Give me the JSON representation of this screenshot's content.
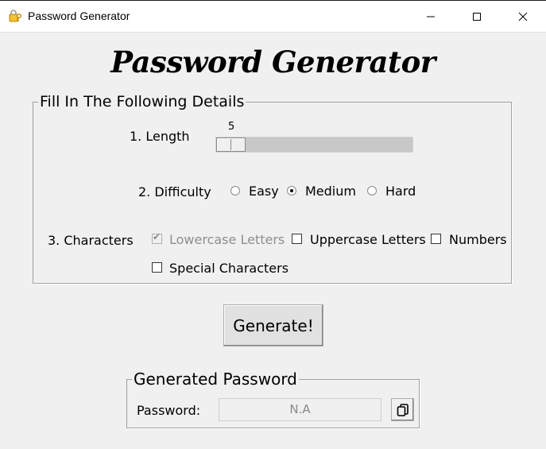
{
  "window": {
    "title": "Password Generator",
    "icons": {
      "app": "key-lock-icon",
      "minimize": "minimize-icon",
      "maximize": "maximize-icon",
      "close": "close-icon"
    }
  },
  "heading": "Password Generator",
  "details": {
    "legend": "Fill In The Following Details",
    "length": {
      "label": "1. Length",
      "value": "5"
    },
    "difficulty": {
      "label": "2. Difficulty",
      "options": [
        "Easy",
        "Medium",
        "Hard"
      ],
      "selected": "Medium"
    },
    "characters": {
      "label": "3. Characters",
      "options": [
        {
          "label": "Lowercase Letters",
          "checked": true,
          "disabled": true
        },
        {
          "label": "Uppercase Letters",
          "checked": false,
          "disabled": false
        },
        {
          "label": "Numbers",
          "checked": false,
          "disabled": false
        },
        {
          "label": "Special Characters",
          "checked": false,
          "disabled": false
        }
      ]
    }
  },
  "generate_button": "Generate!",
  "output": {
    "legend": "Generated Password",
    "label": "Password:",
    "value": "N.A",
    "copy_icon": "copy-icon"
  }
}
